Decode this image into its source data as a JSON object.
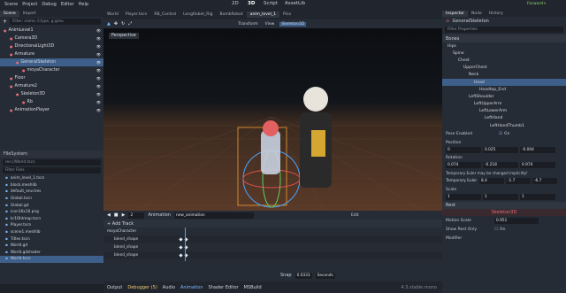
{
  "menu": {
    "items": [
      "Scene",
      "Project",
      "Debug",
      "Editor",
      "Help"
    ],
    "workspaces": [
      "2D",
      "3D",
      "Script",
      "AssetLib"
    ],
    "right": "Forward+"
  },
  "scene_dock": {
    "tabs": [
      "Scene",
      "Import"
    ],
    "filter_placeholder": "Filter: name, t:type, g:grou",
    "nodes": [
      {
        "label": "AnimLevel1",
        "depth": 0,
        "color": "r"
      },
      {
        "label": "Camera3D",
        "depth": 1,
        "color": "r"
      },
      {
        "label": "DirectionalLight3D",
        "depth": 1,
        "color": "r"
      },
      {
        "label": "Armature",
        "depth": 1,
        "color": "r"
      },
      {
        "label": "GeneralSkeleton",
        "depth": 2,
        "color": "r",
        "selected": true
      },
      {
        "label": "moyaCharacter",
        "depth": 3,
        "color": "r"
      },
      {
        "label": "Floor",
        "depth": 1,
        "color": "r"
      },
      {
        "label": "Armature2",
        "depth": 1,
        "color": "r"
      },
      {
        "label": "Skeleton3D",
        "depth": 2,
        "color": "r"
      },
      {
        "label": "Rb",
        "depth": 3,
        "color": "r"
      },
      {
        "label": "AnimationPlayer",
        "depth": 1,
        "color": "r"
      }
    ]
  },
  "filesystem": {
    "title": "FileSystem",
    "path": "res://World.tscn",
    "filter_placeholder": "Filter Files",
    "files": [
      "anim_level_1.tscn",
      "block.meshlib",
      "default_env.tres",
      "Global.tscn",
      "Global.gd",
      "icon16x16.png",
      "kr1Ohlmap.tscn",
      "Player.tscn",
      "scene1.meshlib",
      "Titles.tscn",
      "World.gd",
      "World.gdshader",
      "World.tscn"
    ]
  },
  "editor_tabs": [
    "World",
    "Player.tscn",
    "RB_Control",
    "LongRobot_Rig",
    "BombRobot",
    "anim_level_1",
    "Pico"
  ],
  "viewport": {
    "label": "Perspective",
    "toolbar": [
      "Transform",
      "View"
    ],
    "skeleton_btn": "Skeleton3D"
  },
  "animation": {
    "frame": "2",
    "label": "Animation",
    "name": "new_animation",
    "edit": "Edit",
    "add_track": "+ Add Track",
    "tracks": [
      "moyaCharacter",
      "blend_shape",
      "blend_shape",
      "blend_shape"
    ],
    "snap": "0.0333",
    "unit": "Seconds",
    "step_label": "Snap"
  },
  "bottom_tabs": [
    "Output",
    "Debugger (5)",
    "Audio",
    "Animation",
    "Shader Editor",
    "MSBuild"
  ],
  "version": "4.3.stable.mono",
  "inspector": {
    "tabs": [
      "Inspector",
      "Node",
      "History"
    ],
    "node": "GeneralSkeleton",
    "filter": "Filter Properties",
    "section": "Bones",
    "bones": [
      {
        "n": "Hips",
        "d": 0
      },
      {
        "n": "Spine",
        "d": 1
      },
      {
        "n": "Chest",
        "d": 2
      },
      {
        "n": "UpperChest",
        "d": 3
      },
      {
        "n": "Neck",
        "d": 4
      },
      {
        "n": "Head",
        "d": 5,
        "sel": true
      },
      {
        "n": "Headtop_End",
        "d": 6
      },
      {
        "n": "LeftShoulder",
        "d": 4
      },
      {
        "n": "LeftUpperArm",
        "d": 5
      },
      {
        "n": "LeftLowerArm",
        "d": 6
      },
      {
        "n": "LeftHand",
        "d": 7
      },
      {
        "n": "LeftHandThumb1",
        "d": 8
      }
    ],
    "pose_enabled": "Pose Enabled",
    "on": "On",
    "position": "Position",
    "pos": [
      "0",
      "0.025",
      "-0.004"
    ],
    "rotation": "Rotation",
    "rot": [
      "0.074",
      "-0.218",
      "0.974"
    ],
    "warning": "Temporary Euler may be changed implicitly!",
    "temp_euler": "Temporary Euler",
    "euler": [
      "8.4",
      "-1.7",
      "-6.7"
    ],
    "scale": "Scale",
    "sc": [
      "1",
      "1",
      "1"
    ],
    "rest": "Rest",
    "skeleton": "Skeleton3D",
    "motion_scale": "Motion Scale",
    "motion_val": "0.951",
    "show_rest": "Show Rest Only",
    "show_on": "On",
    "modifier": "Modifier"
  },
  "colors": {
    "accent": "#4aa3ff",
    "warn": "#f0c674",
    "bg": "#1d2229",
    "panel": "#262c35"
  }
}
